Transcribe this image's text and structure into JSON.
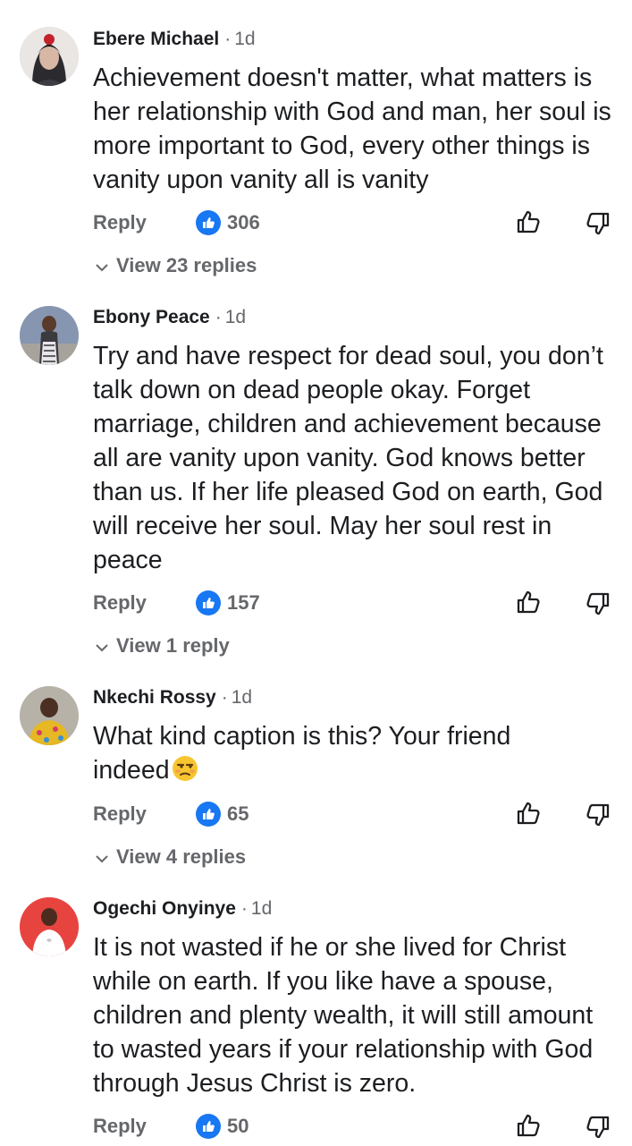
{
  "comments": [
    {
      "author": "Ebere Michael",
      "time": "1d",
      "text": "Achievement doesn't matter, what matters is her relationship with God and man, her soul is more important to God, every other things is vanity upon vanity all is vanity",
      "reply_label": "Reply",
      "likes": "306",
      "replies_label": "View 23 replies"
    },
    {
      "author": "Ebony Peace",
      "time": "1d",
      "text": "Try and have respect for dead soul, you don’t talk down on dead people okay. Forget marriage, children and achievement because all are vanity upon vanity. God knows better than us. If her life pleased God on earth, God will receive her soul. May her soul rest in peace",
      "reply_label": "Reply",
      "likes": "157",
      "replies_label": "View 1 reply"
    },
    {
      "author": "Nkechi Rossy",
      "time": "1d",
      "text": "What kind caption is this? Your friend indeed",
      "reply_label": "Reply",
      "likes": "65",
      "replies_label": "View 4 replies"
    },
    {
      "author": "Ogechi Onyinye",
      "time": "1d",
      "text": "It is not wasted if he or she lived for Christ while on earth. If you like have a spouse, children and plenty wealth, it will still amount to wasted years if your relationship with God through Jesus Christ is zero.",
      "reply_label": "Reply",
      "likes": "50"
    }
  ],
  "colors": {
    "text": "#1c1e21",
    "secondary": "#65676b",
    "like_blue": "#1877f2"
  },
  "icons": [
    "like-badge-icon",
    "thumbs-up-icon",
    "thumbs-down-icon",
    "chevron-down-icon",
    "unamused-face-emoji"
  ]
}
